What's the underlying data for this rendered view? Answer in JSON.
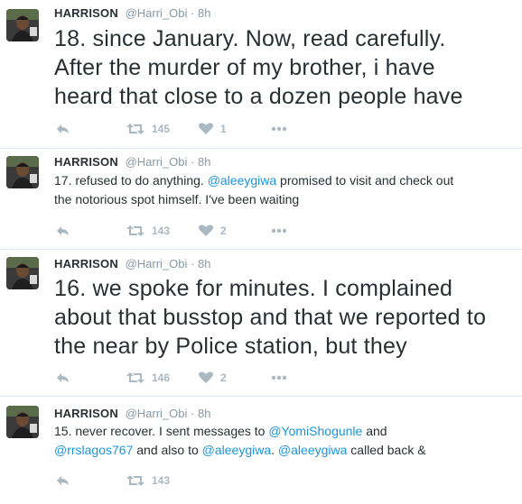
{
  "tweets": [
    {
      "name": "HARRISON",
      "handle": "@Harri_Obi",
      "separator": "·",
      "time": "8h",
      "lines": [
        [
          {
            "t": "18. since January. Now, read carefully."
          }
        ],
        [
          {
            "t": "After the murder of my brother, i have"
          }
        ],
        [
          {
            "t": "heard that close to a dozen people have"
          }
        ]
      ],
      "retweets": "145",
      "likes": "1"
    },
    {
      "name": "HARRISON",
      "handle": "@Harri_Obi",
      "separator": "·",
      "time": "8h",
      "lines": [
        [
          {
            "t": "17. refused to do anything. "
          },
          {
            "t": "@aleeygiwa",
            "link": true
          },
          {
            "t": " promised to visit and check out"
          }
        ],
        [
          {
            "t": "the notorious spot himself. I've been waiting"
          }
        ]
      ],
      "retweets": "143",
      "likes": "2"
    },
    {
      "name": "HARRISON",
      "handle": "@Harri_Obi",
      "separator": "·",
      "time": "8h",
      "lines": [
        [
          {
            "t": "16. we spoke for minutes. I complained"
          }
        ],
        [
          {
            "t": "about that busstop and that we reported to"
          }
        ],
        [
          {
            "t": "the near by Police station, but they"
          }
        ]
      ],
      "retweets": "146",
      "likes": "2"
    },
    {
      "name": "HARRISON",
      "handle": "@Harri_Obi",
      "separator": "·",
      "time": "8h",
      "lines": [
        [
          {
            "t": "15. never recover. I sent messages to "
          },
          {
            "t": "@YomiShogunle",
            "link": true
          },
          {
            "t": " and"
          }
        ],
        [
          {
            "t": "@rrslagos767",
            "link": true
          },
          {
            "t": " and also to "
          },
          {
            "t": "@aleeygiwa",
            "link": true
          },
          {
            "t": ". "
          },
          {
            "t": "@aleeygiwa",
            "link": true
          },
          {
            "t": " called back &"
          }
        ]
      ],
      "retweets": "143",
      "likes": ""
    }
  ],
  "icons": {
    "reply": "reply-icon",
    "retweet": "retweet-icon",
    "like": "heart-icon",
    "more": "more-icon",
    "avatar": "avatar-photo"
  },
  "colors": {
    "text": "#292f33",
    "muted": "#8899a6",
    "action": "#aab8c2",
    "link": "#1b95e0",
    "divider": "#e1e8ed"
  }
}
